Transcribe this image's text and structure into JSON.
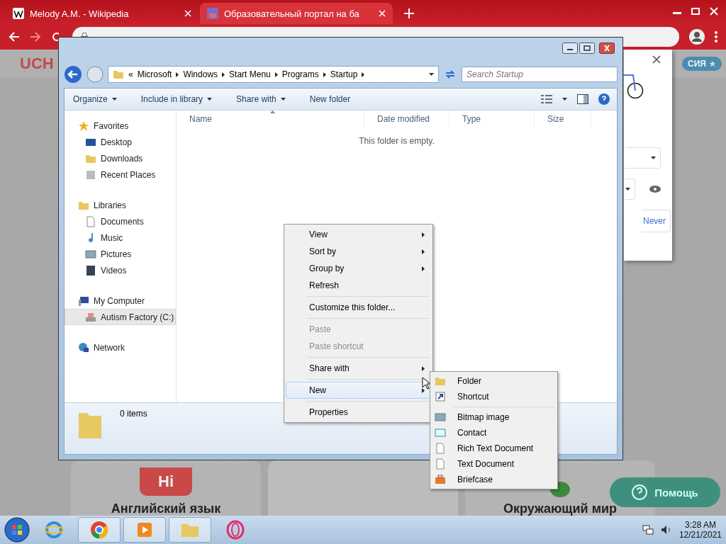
{
  "browser": {
    "tabs": [
      {
        "title": "Melody A.M. - Wikipedia",
        "kind": "wiki",
        "selected": false
      },
      {
        "title": "Образовательный портал на ба",
        "kind": "site",
        "selected": true
      }
    ]
  },
  "page": {
    "logo": "UCH",
    "badge": "СИЯ",
    "hi_label": "Hi",
    "cards": [
      {
        "title": "Английский язык"
      },
      {
        "title": "Окружающий мир"
      }
    ],
    "help_button": "Помощь",
    "password_popup": {
      "button": "Never"
    }
  },
  "explorer": {
    "overflow": "«",
    "breadcrumb": [
      "Microsoft",
      "Windows",
      "Start Menu",
      "Programs",
      "Startup"
    ],
    "search": {
      "placeholder": "Search Startup"
    },
    "toolbar": [
      {
        "label": "Organize",
        "dropdown": true
      },
      {
        "label": "Include in library",
        "dropdown": true
      },
      {
        "label": "Share with",
        "dropdown": true
      },
      {
        "label": "New folder",
        "dropdown": false
      }
    ],
    "nav": [
      {
        "label": "Favorites",
        "kind": "star",
        "selected": false,
        "children": [
          {
            "label": "Desktop",
            "kind": "desktop",
            "selected": false
          },
          {
            "label": "Downloads",
            "kind": "downloads",
            "selected": false
          },
          {
            "label": "Recent Places",
            "kind": "recent",
            "selected": false
          }
        ]
      },
      {
        "label": "Libraries",
        "kind": "libraries",
        "selected": false,
        "children": [
          {
            "label": "Documents",
            "kind": "document",
            "selected": false
          },
          {
            "label": "Music",
            "kind": "music",
            "selected": false
          },
          {
            "label": "Pictures",
            "kind": "pictures",
            "selected": false
          },
          {
            "label": "Videos",
            "kind": "videos",
            "selected": false
          }
        ]
      },
      {
        "label": "My Computer",
        "kind": "computer",
        "selected": false,
        "children": [
          {
            "label": "Autism Factory (C:)",
            "kind": "drive",
            "selected": true
          }
        ]
      },
      {
        "label": "Network",
        "kind": "network",
        "selected": false
      }
    ],
    "columns": [
      {
        "label": "Name",
        "sorted": true
      },
      {
        "label": "Date modified",
        "sorted": false
      },
      {
        "label": "Type",
        "sorted": false
      },
      {
        "label": "Size",
        "sorted": false
      }
    ],
    "empty_text": "This folder is empty.",
    "status": "0 items"
  },
  "context_menu": {
    "groups": [
      [
        {
          "label": "View",
          "submenu": true,
          "disabled": false,
          "selected": false
        },
        {
          "label": "Sort by",
          "submenu": true,
          "disabled": false,
          "selected": false
        },
        {
          "label": "Group by",
          "submenu": true,
          "disabled": false,
          "selected": false
        },
        {
          "label": "Refresh",
          "submenu": false,
          "disabled": false,
          "selected": false
        }
      ],
      [
        {
          "label": "Customize this folder...",
          "submenu": false,
          "disabled": false,
          "selected": false
        }
      ],
      [
        {
          "label": "Paste",
          "submenu": false,
          "disabled": true,
          "selected": false
        },
        {
          "label": "Paste shortcut",
          "submenu": false,
          "disabled": true,
          "selected": false
        }
      ],
      [
        {
          "label": "Share with",
          "submenu": true,
          "disabled": false,
          "selected": false
        }
      ],
      [
        {
          "label": "New",
          "submenu": true,
          "disabled": false,
          "selected": true
        }
      ],
      [
        {
          "label": "Properties",
          "submenu": false,
          "disabled": false,
          "selected": false
        }
      ]
    ]
  },
  "submenu": {
    "groups": [
      [
        {
          "label": "Folder",
          "kind": "folder"
        },
        {
          "label": "Shortcut",
          "kind": "shortcut"
        }
      ],
      [
        {
          "label": "Bitmap image",
          "kind": "bitmap"
        },
        {
          "label": "Contact",
          "kind": "contact"
        },
        {
          "label": "Rich Text Document",
          "kind": "rtf"
        },
        {
          "label": "Text Document",
          "kind": "text"
        },
        {
          "label": "Briefcase",
          "kind": "briefcase"
        }
      ]
    ]
  },
  "taskbar": {
    "apps": [
      {
        "kind": "ie",
        "active": false
      },
      {
        "kind": "chrome",
        "active": true
      },
      {
        "kind": "media",
        "active": true
      },
      {
        "kind": "explorer",
        "active": true
      },
      {
        "kind": "opera",
        "active": false
      }
    ],
    "time": "3:28 AM",
    "date": "12/21/2021"
  }
}
